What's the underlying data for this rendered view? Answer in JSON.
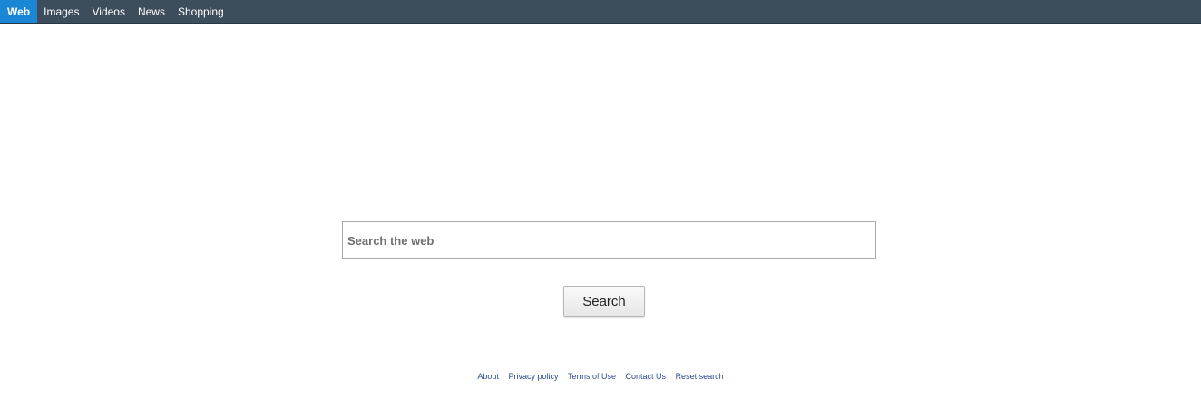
{
  "nav": {
    "tabs": [
      {
        "label": "Web",
        "active": true
      },
      {
        "label": "Images",
        "active": false
      },
      {
        "label": "Videos",
        "active": false
      },
      {
        "label": "News",
        "active": false
      },
      {
        "label": "Shopping",
        "active": false
      }
    ]
  },
  "search": {
    "placeholder": "Search the web",
    "value": "",
    "button_label": "Search"
  },
  "footer": {
    "links": [
      "About",
      "Privacy policy",
      "Terms of Use",
      "Contact Us",
      "Reset search"
    ]
  },
  "colors": {
    "topbar": "#3d4d5c",
    "active_tab": "#1a86d6",
    "footer_link": "#2c4a8c"
  }
}
